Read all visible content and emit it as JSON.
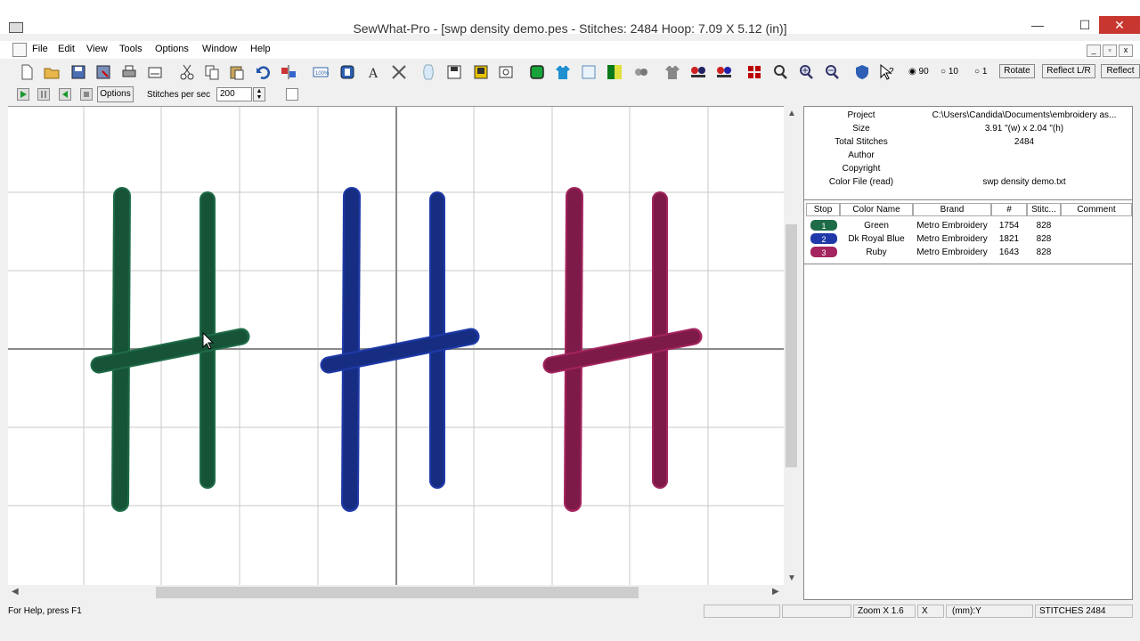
{
  "window": {
    "title": "SewWhat-Pro - [swp density demo.pes - Stitches: 2484  Hoop: 7.09 X 5.12 (in)]",
    "minimize": "—",
    "maximize": "☐",
    "close": "✕"
  },
  "menu": {
    "items": [
      "File",
      "Edit",
      "View",
      "Tools",
      "Options",
      "Window",
      "Help"
    ],
    "mdi_min": "_",
    "mdi_max": "▫",
    "mdi_close": "x"
  },
  "toolbar": {
    "rotate_options": [
      "90",
      "10",
      "1"
    ],
    "rotate_label": "Rotate",
    "reflect_lr_label": "Reflect L/R",
    "reflect_label": "Reflect"
  },
  "playback": {
    "options_label": "Options",
    "stitches_per_sec_label": "Stitches per sec",
    "stitches_per_sec_value": "200"
  },
  "info": {
    "rows": [
      {
        "label": "Project",
        "value": "C:\\Users\\Candida\\Documents\\embroidery as..."
      },
      {
        "label": "Size",
        "value": "3.91 \"(w) x 2.04 \"(h)"
      },
      {
        "label": "Total Stitches",
        "value": "2484"
      },
      {
        "label": "Author",
        "value": ""
      },
      {
        "label": "Copyright",
        "value": ""
      },
      {
        "label": "Color File (read)",
        "value": "swp density demo.txt"
      }
    ]
  },
  "color_table": {
    "headers": [
      "Stop",
      "Color Name",
      "Brand",
      "#",
      "Stitc...",
      "Comment"
    ],
    "rows": [
      {
        "stop": "1",
        "name": "Green",
        "brand": "Metro Embroidery",
        "num": "1754",
        "stitches": "828",
        "color": "#1e6b47"
      },
      {
        "stop": "2",
        "name": "Dk Royal Blue",
        "brand": "Metro Embroidery",
        "num": "1821",
        "stitches": "828",
        "color": "#1f3aa8"
      },
      {
        "stop": "3",
        "name": "Ruby",
        "brand": "Metro Embroidery",
        "num": "1643",
        "stitches": "828",
        "color": "#a3245e"
      }
    ]
  },
  "design": {
    "letters": [
      {
        "color": "#1f6b48",
        "shade": "#134a30"
      },
      {
        "color": "#1f3aa8",
        "shade": "#142873"
      },
      {
        "color": "#a3245e",
        "shade": "#6e1640"
      }
    ]
  },
  "status": {
    "help": "For Help, press F1",
    "zoom": "Zoom X 1.6",
    "x": "X",
    "units": "(mm):Y",
    "stitches": "STITCHES  2484"
  }
}
